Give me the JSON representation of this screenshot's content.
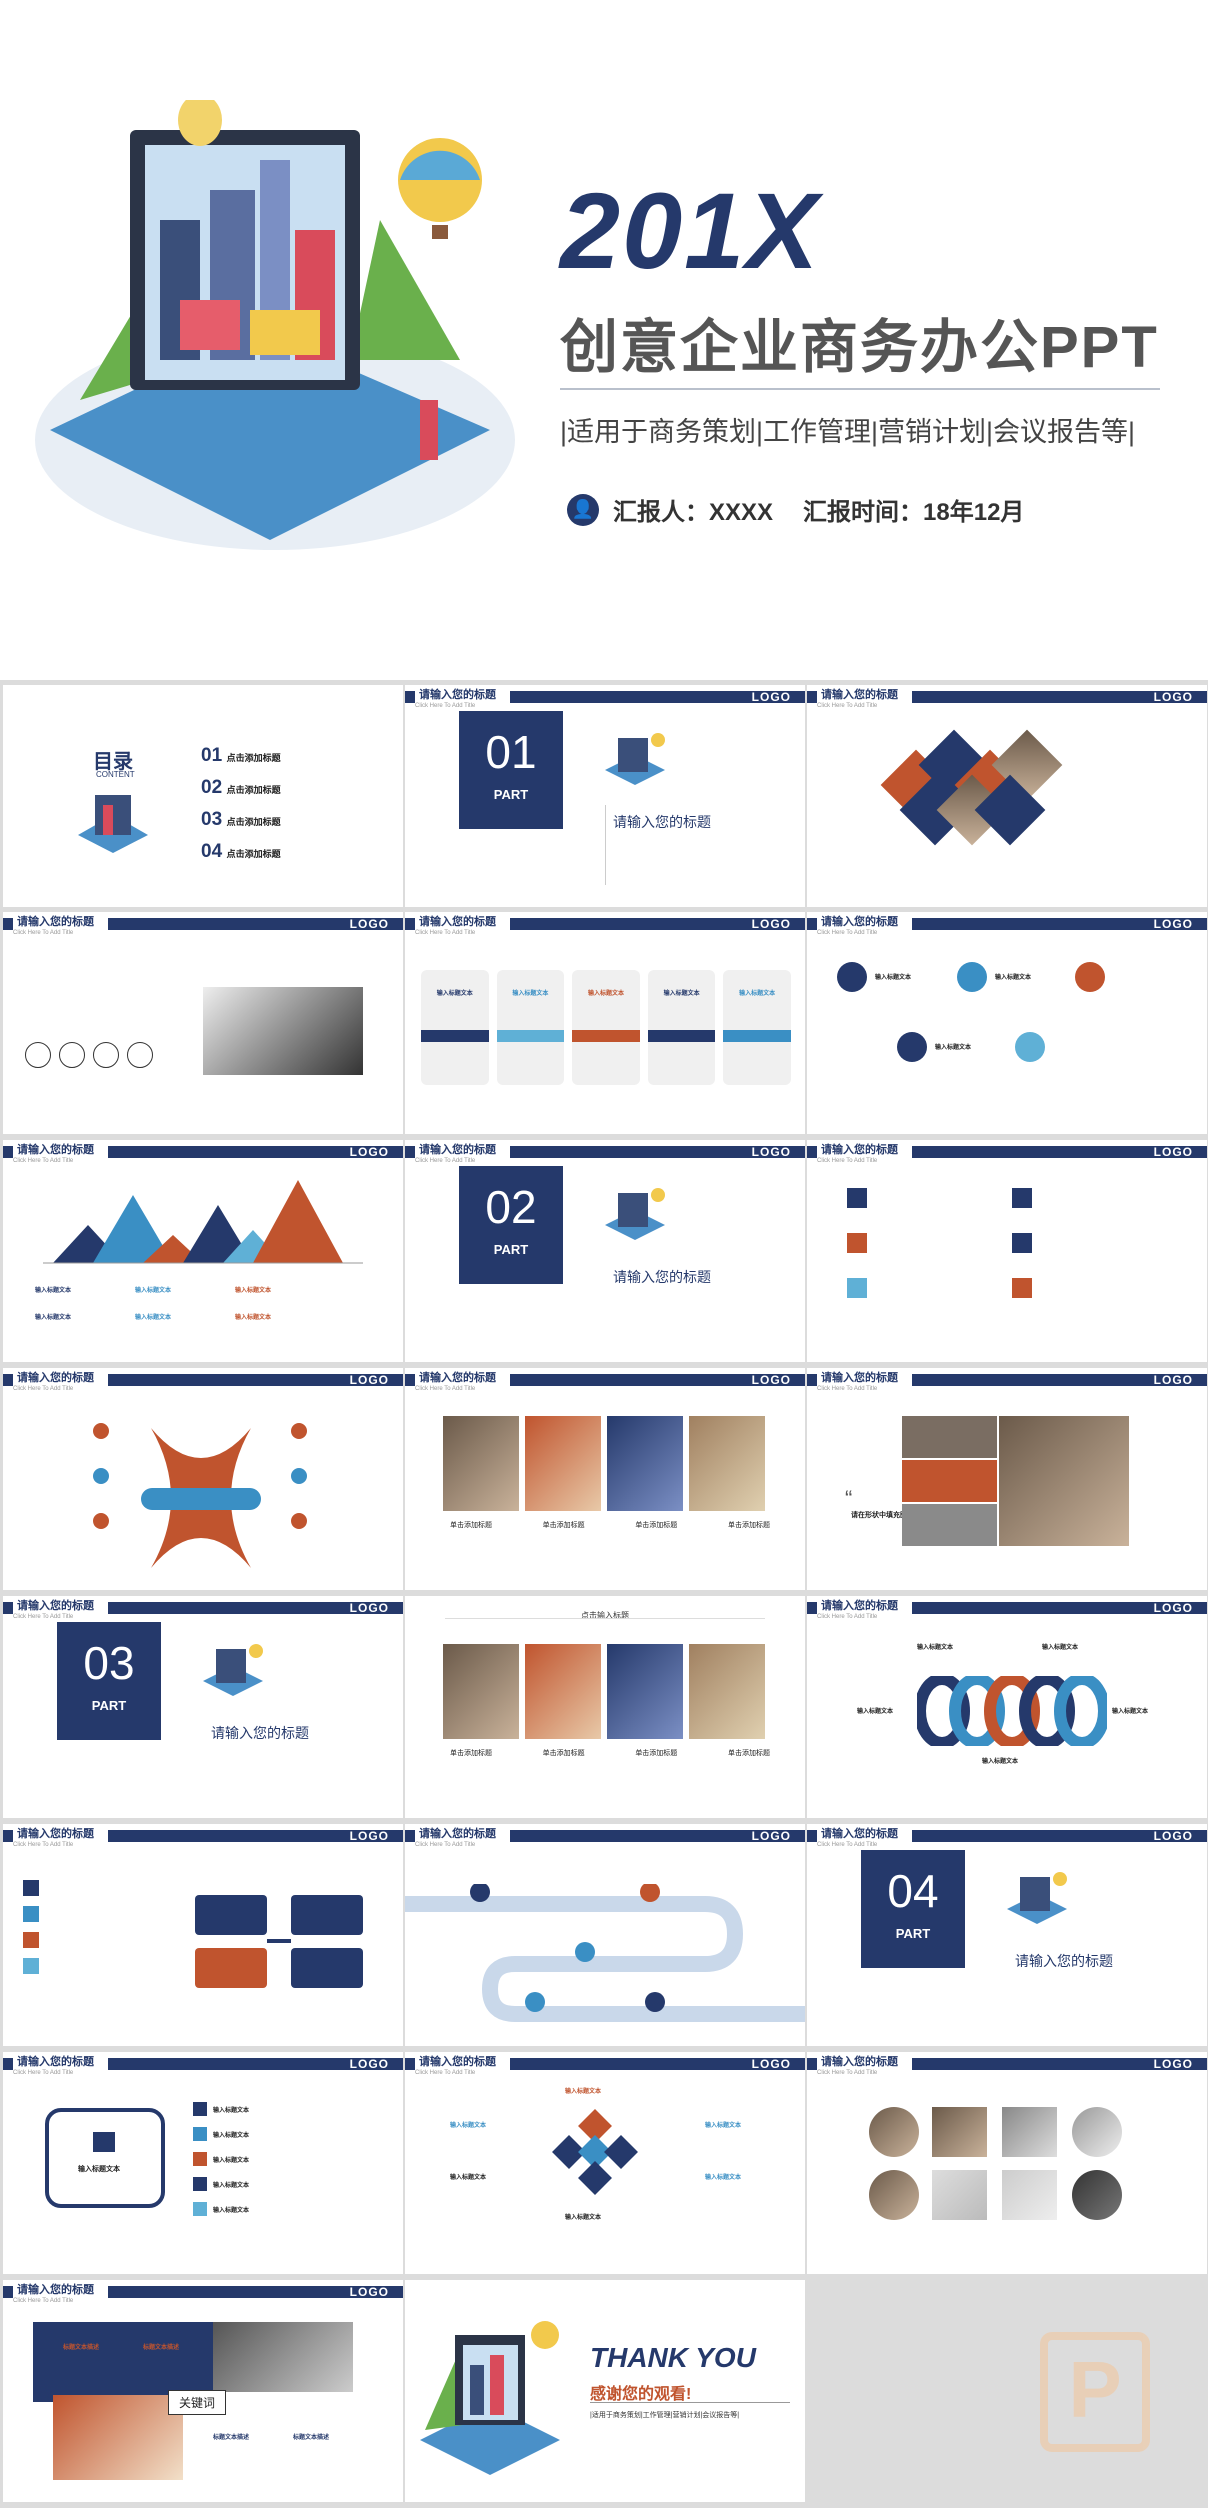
{
  "cover": {
    "big": "201X",
    "title": "创意企业商务办公PPT",
    "tags": "|适用于商务策划|工作管理|营销计划|会议报告等|",
    "reporter": "汇报人：XXXX",
    "time": "汇报时间：18年12月"
  },
  "header": {
    "title": "请输入您的标题",
    "subtitle": "Click Here To Add Title",
    "logo": "LOGO"
  },
  "toc": {
    "title": "目录",
    "subtitle": "CONTENT",
    "items": [
      {
        "num": "01",
        "label": "点击添加标题"
      },
      {
        "num": "02",
        "label": "点击添加标题"
      },
      {
        "num": "03",
        "label": "点击添加标题"
      },
      {
        "num": "04",
        "label": "点击添加标题"
      }
    ]
  },
  "parts": [
    {
      "num": "01",
      "label": "PART",
      "title": "请输入您的标题"
    },
    {
      "num": "02",
      "label": "PART",
      "title": "请输入您的标题"
    },
    {
      "num": "03",
      "label": "PART",
      "title": "请输入您的标题"
    },
    {
      "num": "04",
      "label": "PART",
      "title": "请输入您的标题"
    }
  ],
  "common": {
    "input_text": "输入标题文本",
    "click_title": "单击添加标题",
    "click_input_title": "点击输入标题",
    "add_text": "添加标题文字",
    "fill_photo": "请在形状中填充图片",
    "keyword": "关键词",
    "title_text": "标题文本描述"
  },
  "ending": {
    "thanks": "THANK YOU",
    "sub": "感谢您的观看!",
    "tags": "|适用于商务策划|工作管理|营销计划|会议报告等|"
  }
}
